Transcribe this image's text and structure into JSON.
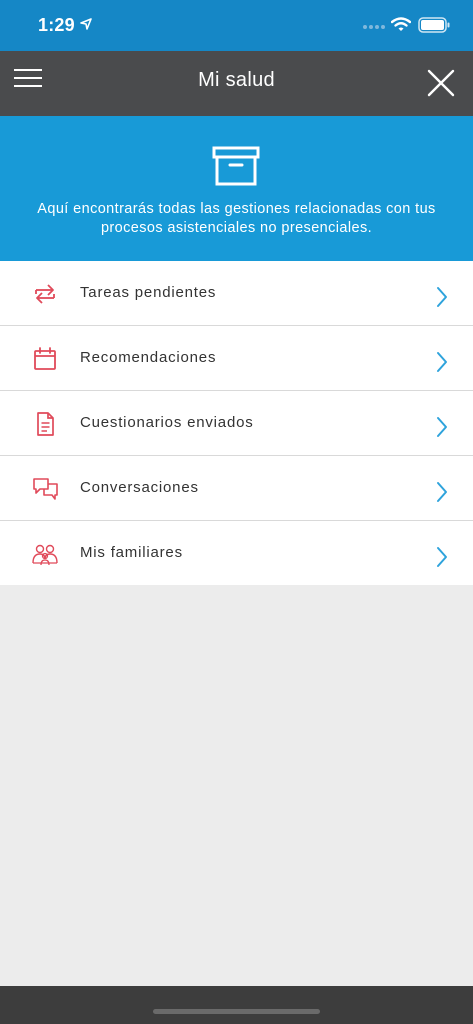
{
  "status_bar": {
    "time": "1:29"
  },
  "nav": {
    "title": "Mi salud"
  },
  "hero": {
    "icon": "archive-box-icon",
    "text": "Aquí encontrarás todas las gestiones relacionadas con tus procesos asistenciales no presenciales."
  },
  "menu": {
    "items": [
      {
        "label": "Tareas pendientes",
        "icon": "repeat-arrows-icon"
      },
      {
        "label": "Recomendaciones",
        "icon": "calendar-icon"
      },
      {
        "label": "Cuestionarios enviados",
        "icon": "document-icon"
      },
      {
        "label": "Conversaciones",
        "icon": "chat-bubbles-icon"
      },
      {
        "label": "Mis familiares",
        "icon": "family-icon"
      }
    ]
  },
  "colors": {
    "status_bar": "#1587c6",
    "nav_bar": "#4a4b4d",
    "hero": "#189ad7",
    "icon_accent": "#e04a5a",
    "chevron": "#2ea3dc",
    "background": "#ececec"
  }
}
